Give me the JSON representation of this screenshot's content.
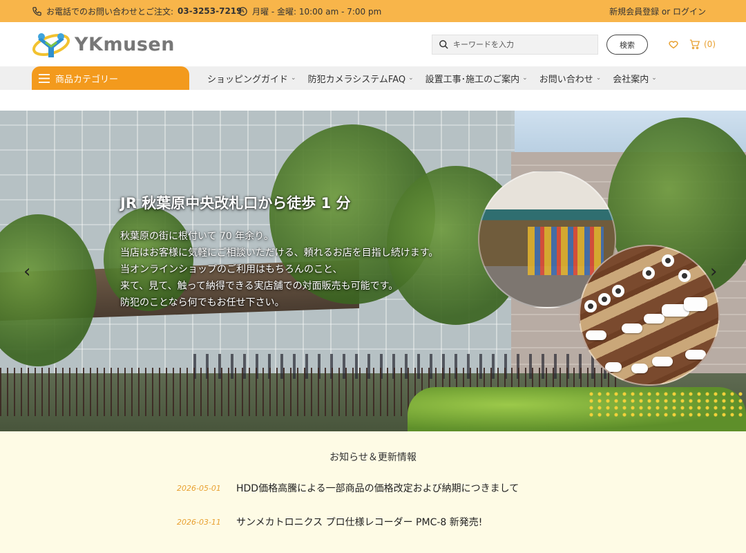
{
  "topbar": {
    "phone_prefix": "お電話でのお問い合わせとご注文: ",
    "phone_number": "03-3253-7219",
    "hours": "月曜 - 金曜: 10:00 am - 7:00 pm",
    "register": "新規会員登録",
    "or": " or ",
    "login": "ログイン"
  },
  "header": {
    "logo_text": "YKmusen",
    "search_placeholder": "キーワードを入力",
    "search_button": "検索",
    "cart_count": "(0)",
    "accent_color": "#f39a1d"
  },
  "nav": {
    "category_button": "商品カテゴリー",
    "items": [
      {
        "label": "ショッピングガイド"
      },
      {
        "label": "防犯カメラシステムFAQ"
      },
      {
        "label": "設置工事･施工のご案内"
      },
      {
        "label": "お問い合わせ"
      },
      {
        "label": "会社案内"
      }
    ]
  },
  "hero": {
    "title": "JR 秋葉原中央改札口から徒歩 1 分",
    "lines": [
      "秋葉原の街に根付いて 70 年余り。",
      "当店はお客様に気軽にご相談いただける、頼れるお店を目指し続けます。",
      "当オンラインショップのご利用はもちろんのこと、",
      "来て、見て、触って納得できる実店舗での対面販売も可能です。",
      "防犯のことなら何でもお任せ下さい。"
    ]
  },
  "news": {
    "title": "お知らせ＆更新情報",
    "items": [
      {
        "date": "2026-05-01",
        "text": "HDD価格高騰による一部商品の価格改定および納期につきまして"
      },
      {
        "date": "2026-03-11",
        "text": "サンメカトロニクス プロ仕様レコーダー PMC-8 新発売!"
      }
    ]
  }
}
